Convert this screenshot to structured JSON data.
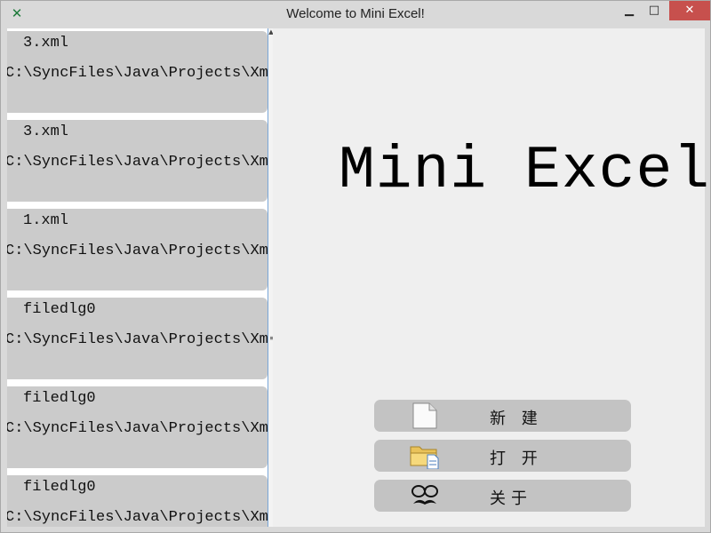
{
  "window": {
    "title": "Welcome to Mini Excel!",
    "app_icon": "excel-x-icon",
    "controls": {
      "minimize": "▁",
      "maximize": "□",
      "close": "✕"
    }
  },
  "file_list": {
    "items": [
      {
        "name": "3.xml",
        "path": "C:\\SyncFiles\\Java\\Projects\\Xml"
      },
      {
        "name": "3.xml",
        "path": "C:\\SyncFiles\\Java\\Projects\\Xml"
      },
      {
        "name": "1.xml",
        "path": "C:\\SyncFiles\\Java\\Projects\\Xml"
      },
      {
        "name": "filedlg0",
        "path": "C:\\SyncFiles\\Java\\Projects\\Xml"
      },
      {
        "name": "filedlg0",
        "path": "C:\\SyncFiles\\Java\\Projects\\Xml"
      },
      {
        "name": "filedlg0",
        "path": "C:\\SyncFiles\\Java\\Projects\\Xml"
      }
    ]
  },
  "main": {
    "title": "Mini Excel",
    "buttons": {
      "new": {
        "label": "新 建",
        "icon": "blank-document-icon"
      },
      "open": {
        "label": "打 开",
        "icon": "folder-open-icon"
      },
      "about": {
        "label": "关于",
        "icon": "glasses-mustache-icon"
      }
    }
  },
  "colors": {
    "card_bg": "#cbcbcb",
    "button_bg": "#c3c3c3",
    "close_red": "#c7504d",
    "splitter_accent": "#7aa7d8"
  }
}
